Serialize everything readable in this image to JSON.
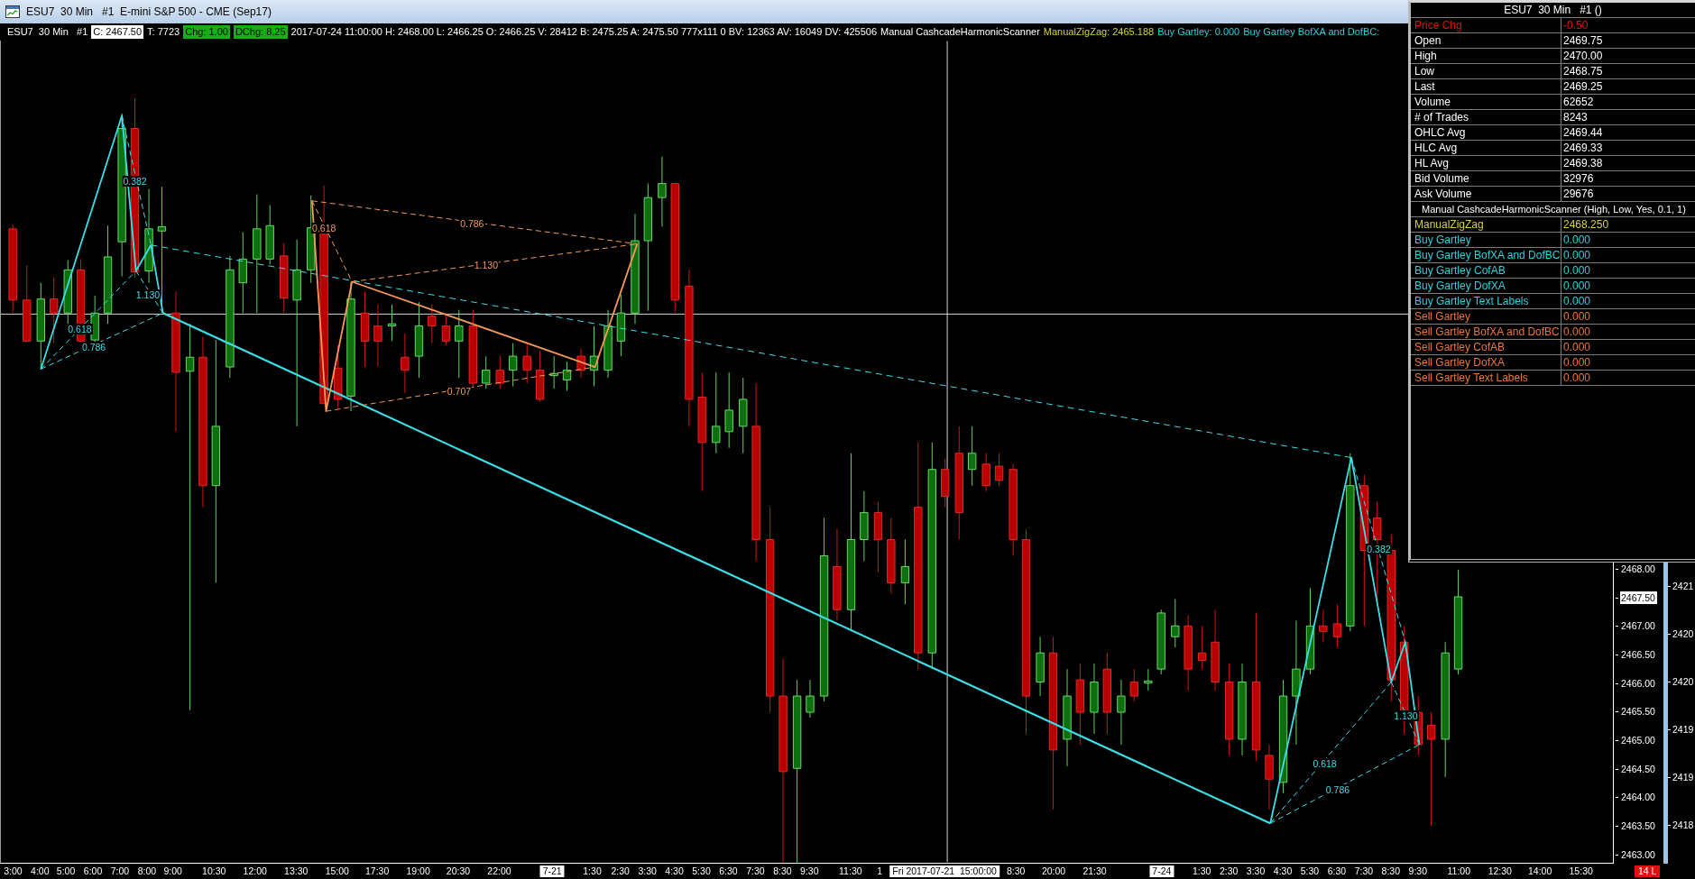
{
  "window": {
    "title": "ESU7  30 Min   #1  E-mini S&P 500 - CME (Sep17)"
  },
  "info_bar": {
    "segments": [
      {
        "text": "ESU7  30 Min   #1",
        "kind": "plain"
      },
      {
        "text": "C: 2467.50",
        "kind": "boxed"
      },
      {
        "text": "T: 7723",
        "kind": "plain"
      },
      {
        "text": "Chg: 1.00",
        "kind": "gain"
      },
      {
        "text": "DChg: 8.25",
        "kind": "gain"
      },
      {
        "text": "2017-07-24 11:00:00 H: 2468.00 L: 2466.25 O: 2466.25 V: 28412 B: 2475.25 A: 2475.50 777x111 0 BV: 12363 AV: 16049 DV: 425506",
        "kind": "plain"
      },
      {
        "text": "Manual CashcadeHarmonicScanner",
        "kind": "plain"
      },
      {
        "text": "ManualZigZag: 2465.188",
        "kind": "study",
        "color": "#d4d040"
      },
      {
        "text": "Buy Gartley: 0.000",
        "kind": "study",
        "color": "#2fcfdc"
      },
      {
        "text": "Buy Gartley BofXA and DofBC:",
        "kind": "study",
        "color": "#2fcfdc"
      }
    ]
  },
  "chart": {
    "patterns": [
      {
        "kind": "buy",
        "ratio_labels": [
          "0.382",
          "1.130",
          "0.618",
          "0.786"
        ]
      },
      {
        "kind": "sell",
        "ratio_labels": [
          "0.786",
          "0.618",
          "1.130",
          "0.707"
        ]
      },
      {
        "kind": "buy",
        "ratio_labels": [
          "0.382",
          "1.130",
          "0.618",
          "0.786"
        ]
      }
    ]
  },
  "price_axis": {
    "labels": [
      {
        "text": "2468.00",
        "highlighted": false
      },
      {
        "text": "2467.50",
        "highlighted": true
      },
      {
        "text": "2467.00",
        "highlighted": false
      },
      {
        "text": "2466.50",
        "highlighted": false
      },
      {
        "text": "2466.00",
        "highlighted": false
      },
      {
        "text": "2465.50",
        "highlighted": false
      },
      {
        "text": "2465.00",
        "highlighted": false
      },
      {
        "text": "2464.50",
        "highlighted": false
      },
      {
        "text": "2464.00",
        "highlighted": false
      },
      {
        "text": "2463.50",
        "highlighted": false
      },
      {
        "text": "2463.00",
        "highlighted": false
      }
    ],
    "secondary_labels": [
      "2421",
      "2420",
      "2420",
      "2419",
      "2419",
      "2418"
    ]
  },
  "time_axis": {
    "labels": [
      {
        "text": "3:00",
        "kind": "time"
      },
      {
        "text": "4:00",
        "kind": "time"
      },
      {
        "text": "5:00",
        "kind": "time"
      },
      {
        "text": "6:00",
        "kind": "time"
      },
      {
        "text": "7:00",
        "kind": "time"
      },
      {
        "text": "8:00",
        "kind": "time"
      },
      {
        "text": "9:00",
        "kind": "time"
      },
      {
        "text": "10:30",
        "kind": "time"
      },
      {
        "text": "12:00",
        "kind": "time"
      },
      {
        "text": "13:30",
        "kind": "time"
      },
      {
        "text": "15:00",
        "kind": "time"
      },
      {
        "text": "17:30",
        "kind": "time"
      },
      {
        "text": "19:00",
        "kind": "time"
      },
      {
        "text": "20:30",
        "kind": "time"
      },
      {
        "text": "22:00",
        "kind": "time"
      },
      {
        "text": "7-21",
        "kind": "date"
      },
      {
        "text": "1:30",
        "kind": "time"
      },
      {
        "text": "2:30",
        "kind": "time"
      },
      {
        "text": "3:30",
        "kind": "time"
      },
      {
        "text": "4:30",
        "kind": "time"
      },
      {
        "text": "5:30",
        "kind": "time"
      },
      {
        "text": "6:30",
        "kind": "time"
      },
      {
        "text": "7:30",
        "kind": "time"
      },
      {
        "text": "8:30",
        "kind": "time"
      },
      {
        "text": "9:30",
        "kind": "time"
      },
      {
        "text": "11:30",
        "kind": "time"
      },
      {
        "text": "1",
        "kind": "time"
      },
      {
        "text": "Fri 2017-07-21  15:00:00",
        "kind": "cursor"
      },
      {
        "text": "8:30",
        "kind": "time"
      },
      {
        "text": "20:00",
        "kind": "time"
      },
      {
        "text": "21:30",
        "kind": "time"
      },
      {
        "text": "7-24",
        "kind": "date"
      },
      {
        "text": "1:30",
        "kind": "time"
      },
      {
        "text": "2:30",
        "kind": "time"
      },
      {
        "text": "3:30",
        "kind": "time"
      },
      {
        "text": "4:30",
        "kind": "time"
      },
      {
        "text": "5:30",
        "kind": "time"
      },
      {
        "text": "6:30",
        "kind": "time"
      },
      {
        "text": "7:30",
        "kind": "time"
      },
      {
        "text": "8:30",
        "kind": "time"
      },
      {
        "text": "9:30",
        "kind": "time"
      },
      {
        "text": "11:00",
        "kind": "time"
      },
      {
        "text": "12:30",
        "kind": "time"
      },
      {
        "text": "14:00",
        "kind": "time"
      },
      {
        "text": "15:30",
        "kind": "time"
      }
    ],
    "badge": "14 L"
  },
  "data_window": {
    "title": "ESU7  30 Min   #1 ()",
    "rows": [
      {
        "label": "Price Chg",
        "value": "-0.50",
        "color": "#e01010"
      },
      {
        "label": "Open",
        "value": "2469.75",
        "color": "#ffffff"
      },
      {
        "label": "High",
        "value": "2470.00",
        "color": "#ffffff"
      },
      {
        "label": "Low",
        "value": "2468.75",
        "color": "#ffffff"
      },
      {
        "label": "Last",
        "value": "2469.25",
        "color": "#ffffff"
      },
      {
        "label": "Volume",
        "value": "62652",
        "color": "#ffffff"
      },
      {
        "label": "# of Trades",
        "value": "8243",
        "color": "#ffffff"
      },
      {
        "label": "OHLC Avg",
        "value": "2469.44",
        "color": "#ffffff"
      },
      {
        "label": "HLC Avg",
        "value": "2469.33",
        "color": "#ffffff"
      },
      {
        "label": "HL Avg",
        "value": "2469.38",
        "color": "#ffffff"
      },
      {
        "label": "Bid Volume",
        "value": "32976",
        "color": "#ffffff"
      },
      {
        "label": "Ask Volume",
        "value": "29676",
        "color": "#ffffff"
      }
    ],
    "study": {
      "title": "Manual CashcadeHarmonicScanner (High, Low, Yes, 0.1, 1)",
      "rows": [
        {
          "label": "ManualZigZag",
          "value": "2468.250",
          "color": "#d4d040"
        },
        {
          "label": "Buy Gartley",
          "value": "0.000",
          "color": "#2fcfdc"
        },
        {
          "label": "Buy Gartley BofXA and DofBC",
          "value": "0.000",
          "color": "#2fcfdc"
        },
        {
          "label": "Buy Gartley CofAB",
          "value": "0.000",
          "color": "#2fcfdc"
        },
        {
          "label": "Buy Gartley DofXA",
          "value": "0.000",
          "color": "#2fcfdc"
        },
        {
          "label": "Buy Gartley Text Labels",
          "value": "0.000",
          "color": "#2fcfdc"
        },
        {
          "label": "Sell Gartley",
          "value": "0.000",
          "color": "#e8773a"
        },
        {
          "label": "Sell Gartley BofXA and DofBC",
          "value": "0.000",
          "color": "#e8773a"
        },
        {
          "label": "Sell Gartley CofAB",
          "value": "0.000",
          "color": "#e8773a"
        },
        {
          "label": "Sell Gartley DofXA",
          "value": "0.000",
          "color": "#e8773a"
        },
        {
          "label": "Sell Gartley Text Labels",
          "value": "0.000",
          "color": "#e8773a"
        }
      ]
    }
  }
}
